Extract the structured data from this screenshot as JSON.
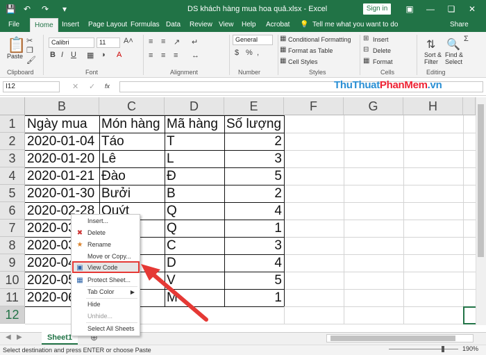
{
  "window": {
    "title": "DS khách hàng mua hoa quả.xlsx - Excel",
    "sign_in": "Sign in",
    "share": "Share",
    "tell_me": "Tell me what you want to do"
  },
  "tabs": [
    "File",
    "Home",
    "Insert",
    "Page Layout",
    "Formulas",
    "Data",
    "Review",
    "View",
    "Help",
    "Acrobat"
  ],
  "ribbon": {
    "paste": "Paste",
    "font_name": "Calibri",
    "font_size": "11",
    "number_format": "General",
    "conditional_formatting": "Conditional Formatting",
    "format_as_table": "Format as Table",
    "cell_styles": "Cell Styles",
    "insert": "Insert",
    "delete": "Delete",
    "format": "Format",
    "sort_filter": "Sort &",
    "sort_filter2": "Filter",
    "find_select": "Find &",
    "find_select2": "Select",
    "groups": [
      "Clipboard",
      "Font",
      "Alignment",
      "Number",
      "Styles",
      "Cells",
      "Editing"
    ]
  },
  "formula_bar": {
    "name_box": "I12",
    "fx": "fx"
  },
  "watermark": {
    "part1": "ThuThuat",
    "part2": "PhanMem",
    "part3": ".vn"
  },
  "columns": [
    "B",
    "C",
    "D",
    "E",
    "F",
    "G",
    "H"
  ],
  "rows": [
    "1",
    "2",
    "3",
    "4",
    "5",
    "6",
    "7",
    "8",
    "9",
    "10",
    "11",
    "12"
  ],
  "table": {
    "headers": [
      "Ngày mua",
      "Món hàng",
      "Mã hàng",
      "Số lượng"
    ],
    "data": [
      [
        "2020-01-04",
        "Táo",
        "T",
        "2"
      ],
      [
        "2020-01-20",
        "Lê",
        "L",
        "3"
      ],
      [
        "2020-01-21",
        "Đào",
        "Đ",
        "5"
      ],
      [
        "2020-01-30",
        "Bưởi",
        "B",
        "2"
      ],
      [
        "2020-02-28",
        "Quýt",
        "Q",
        "4"
      ],
      [
        "2020-03",
        "",
        "Q",
        "1"
      ],
      [
        "2020-03",
        "",
        "C",
        "3"
      ],
      [
        "2020-04",
        "",
        "D",
        "4"
      ],
      [
        "2020-05",
        "",
        "V",
        "5"
      ],
      [
        "2020-06",
        "",
        "M",
        "1"
      ]
    ]
  },
  "sheet_tab": "Sheet1",
  "status": "Select destination and press ENTER or choose Paste",
  "context_menu": {
    "items": [
      "Insert...",
      "Delete",
      "Rename",
      "Move or Copy...",
      "View Code",
      "Protect Sheet...",
      "Tab Color",
      "Hide",
      "Unhide...",
      "Select All Sheets"
    ]
  },
  "zoom": "190%",
  "colors": {
    "excel_green": "#217346",
    "highlight_red": "#e53935"
  }
}
